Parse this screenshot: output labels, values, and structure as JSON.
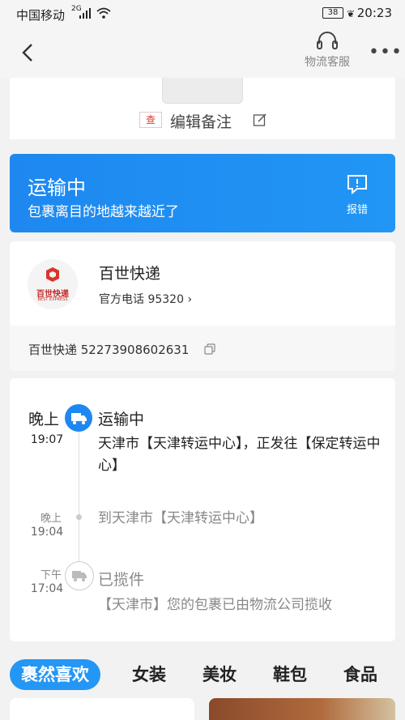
{
  "status_bar": {
    "carrier": "中国移动",
    "network": "2G",
    "battery": "38",
    "time": "20:23"
  },
  "nav": {
    "customer_service_label": "物流客服"
  },
  "remark": {
    "tag": "查",
    "text": "编辑备注"
  },
  "shipment_status": {
    "title": "运输中",
    "subtitle": "包裹离目的地越来越近了",
    "report_label": "报错",
    "color": "#1e88f0"
  },
  "courier": {
    "logo_text": "百世快递",
    "logo_subtext": "BEST EXPRESS",
    "name": "百世快递",
    "phone_text": "官方电话 95320",
    "waybill": "百世快递 52273908602631"
  },
  "timeline": [
    {
      "day": "晚上",
      "time": "19:07",
      "title": "运输中",
      "desc": "天津市【天津转运中心】，正发往【保定转运中心】",
      "icon": "truck-icon"
    },
    {
      "day": "晚上",
      "time": "19:04",
      "title": "",
      "desc": "到天津市【天津转运中心】",
      "icon": "dot-icon"
    },
    {
      "day": "下午",
      "time": "17:04",
      "title": "已揽件",
      "desc": "【天津市】您的包裹已由物流公司揽收",
      "icon": "truck-outline-icon"
    }
  ],
  "tabs": [
    "裹然喜欢",
    "女装",
    "美妆",
    "鞋包",
    "食品"
  ],
  "accent_color": "#2496f5"
}
